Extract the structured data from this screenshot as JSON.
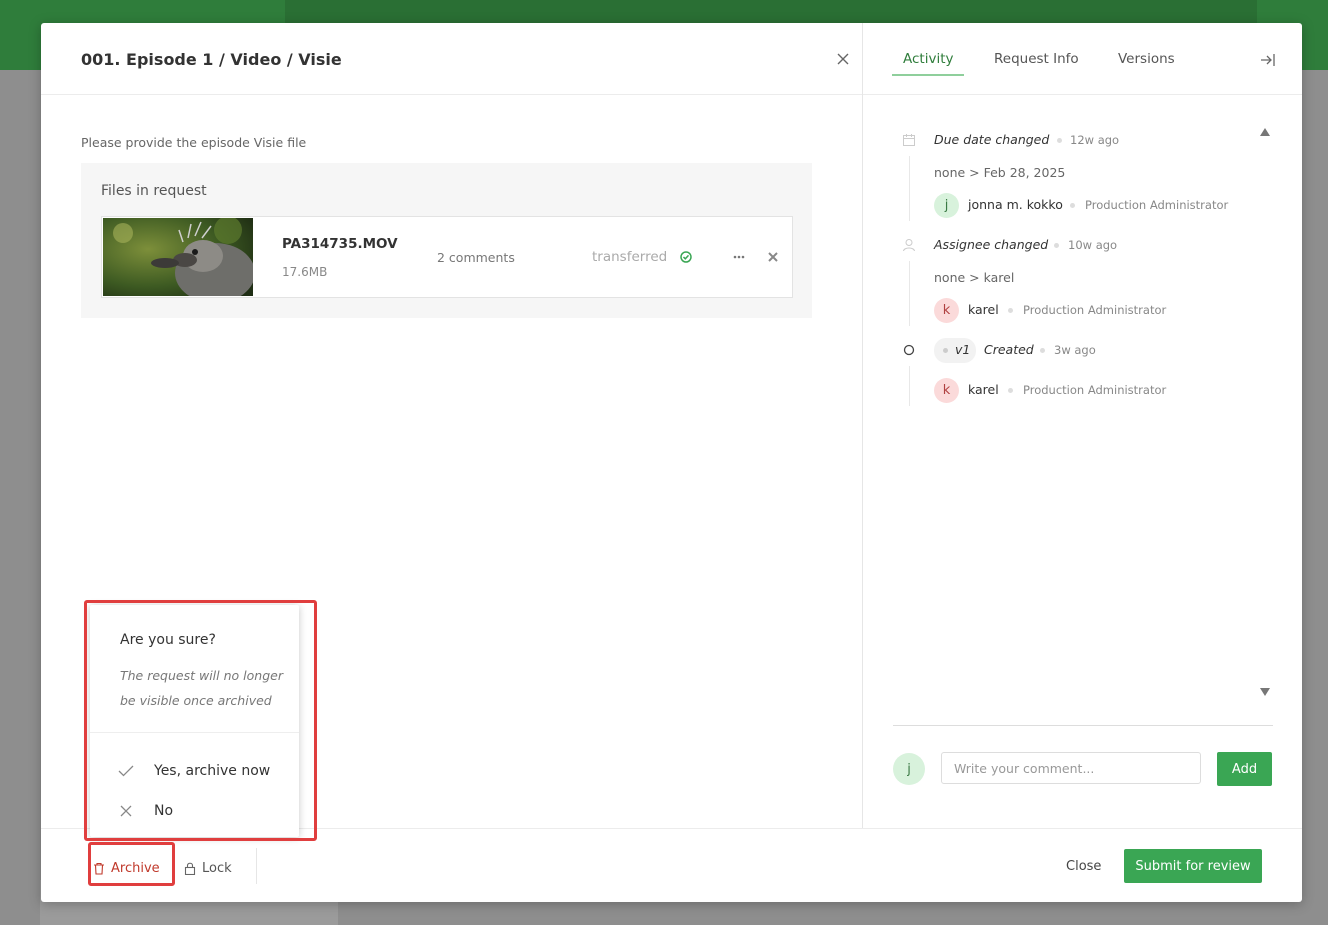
{
  "modal": {
    "title": "001. Episode 1 / Video / Visie",
    "description": "Please provide the episode Visie file",
    "files_title": "Files in request",
    "file": {
      "name": "PA314735.MOV",
      "size": "17.6MB",
      "comments": "2 comments",
      "status": "transferred"
    }
  },
  "footer": {
    "archive_label": "Archive",
    "lock_label": "Lock",
    "close_label": "Close",
    "submit_label": "Submit for review"
  },
  "popup": {
    "title": "Are you sure?",
    "message": "The request will no longer be visible once archived",
    "yes_label": "Yes, archive now",
    "no_label": "No"
  },
  "side": {
    "tabs": [
      "Activity",
      "Request Info",
      "Versions"
    ],
    "active_tab": "Activity",
    "activity": [
      {
        "event": "Due date changed",
        "time": "12w ago",
        "change": "none > Feb 28, 2025",
        "user": "jonna m. kokko",
        "user_initial": "j",
        "role": "Production Administrator"
      },
      {
        "event": "Assignee changed",
        "time": "10w ago",
        "change": "none > karel",
        "user": "karel",
        "user_initial": "k",
        "role": "Production Administrator"
      },
      {
        "version": "v1",
        "event": "Created",
        "time": "3w ago",
        "user": "karel",
        "user_initial": "k",
        "role": "Production Administrator"
      }
    ],
    "comment_avatar": "j",
    "comment_placeholder": "Write your comment...",
    "add_label": "Add"
  },
  "colors": {
    "brand_green": "#3aa654",
    "header_green": "#2f7d3b",
    "danger_red": "#e03e3e"
  },
  "icons": [
    "close-icon",
    "check-circle-icon",
    "more-icon",
    "remove-icon",
    "trash-icon",
    "lock-icon",
    "check-icon",
    "x-icon",
    "calendar-icon",
    "user-icon",
    "collapse-panel-icon"
  ]
}
